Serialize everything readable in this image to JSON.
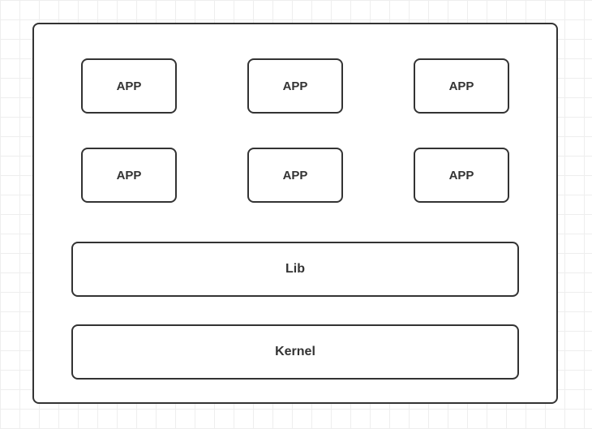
{
  "apps_row1": [
    {
      "label": "APP"
    },
    {
      "label": "APP"
    },
    {
      "label": "APP"
    }
  ],
  "apps_row2": [
    {
      "label": "APP"
    },
    {
      "label": "APP"
    },
    {
      "label": "APP"
    }
  ],
  "lib": {
    "label": "Lib"
  },
  "kernel": {
    "label": "Kernel"
  }
}
